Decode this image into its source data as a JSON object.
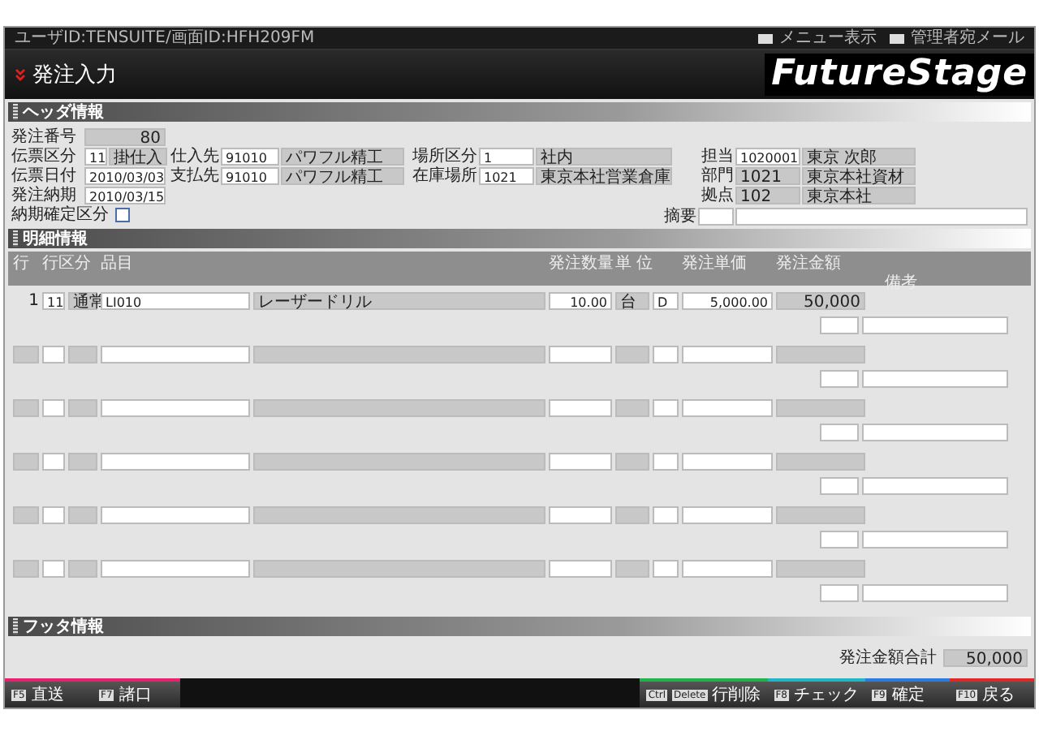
{
  "top_bar": {
    "user_info": "ユーザID:TENSUITE/画面ID:HFH209FM",
    "links": [
      {
        "label": "メニュー表示"
      },
      {
        "label": "管理者宛メール"
      }
    ]
  },
  "title": "発注入力",
  "logo": "FutureStage",
  "header": {
    "section_title": "ヘッダ情報",
    "columns": [
      [
        {
          "kind": "display",
          "label": "発注番号",
          "value": "80"
        },
        {
          "kind": "code_name",
          "label": "伝票区分",
          "value": "11",
          "name": "掛仕入"
        },
        {
          "kind": "input",
          "label": "伝票日付",
          "value": "2010/03/03"
        },
        {
          "kind": "input",
          "label": "発注納期",
          "value": "2010/03/15"
        },
        {
          "kind": "checkbox",
          "label": "納期確定区分",
          "checked": false
        }
      ],
      [
        {
          "kind": "code_name",
          "label": "仕入先",
          "value": "91010",
          "name": "パワフル精工"
        },
        {
          "kind": "code_name",
          "label": "支払先",
          "value": "91010",
          "name": "パワフル精工"
        }
      ],
      [
        {
          "kind": "code_name",
          "label": "場所区分",
          "value": "1",
          "name": "社内"
        },
        {
          "kind": "code_name",
          "label": "在庫場所",
          "value": "1021",
          "name": "東京本社営業倉庫"
        }
      ],
      [
        {
          "kind": "code_name",
          "label": "担当",
          "value": "1020001",
          "name": "東京 次郎"
        },
        {
          "kind": "display_name",
          "label": "部門",
          "value": "1021",
          "name": "東京本社資材"
        },
        {
          "kind": "display_name",
          "label": "拠点",
          "value": "102",
          "name": "東京本社"
        }
      ]
    ],
    "memo": {
      "label": "摘要"
    }
  },
  "detail": {
    "section_title": "明細情報",
    "columns": [
      {
        "label": "行"
      },
      {
        "label": "行区分"
      },
      {
        "label": "品目"
      },
      {
        "label": "発注数量"
      },
      {
        "label": "単 位"
      },
      {
        "label": "発注単価"
      },
      {
        "label": "発注金額"
      },
      {
        "label": "備考"
      }
    ],
    "rows": [
      {
        "kind": "filled",
        "line": "1",
        "type_code": "11",
        "type_name": "通常",
        "item_code": "LI010",
        "item_name": "レーザードリル",
        "quantity": "10.00",
        "unit": "台",
        "unit_flag": "D",
        "unit_price": "5,000.00",
        "amount": "50,000"
      },
      {
        "kind": "blank"
      },
      {
        "kind": "blank"
      },
      {
        "kind": "blank"
      },
      {
        "kind": "blank"
      },
      {
        "kind": "blank"
      }
    ]
  },
  "footer": {
    "section_title": "フッタ情報",
    "total_label": "発注金額合計",
    "total_value": "50,000"
  },
  "function_keys": {
    "left": [
      {
        "keys": [
          "F5"
        ],
        "label": "直送",
        "color": "#e8206e"
      },
      {
        "keys": [
          "F7"
        ],
        "label": "諸口",
        "color": "#e8206e"
      }
    ],
    "right": [
      {
        "keys": [
          "Ctrl",
          "Delete"
        ],
        "label": "行削除",
        "color": "#22b24c"
      },
      {
        "keys": [
          "F8"
        ],
        "label": "チェック",
        "color": "#1fb5c4"
      },
      {
        "keys": [
          "F9"
        ],
        "label": "確定",
        "color": "#2a7de0"
      },
      {
        "keys": [
          "F10"
        ],
        "label": "戻る",
        "color": "#e02828"
      }
    ]
  }
}
